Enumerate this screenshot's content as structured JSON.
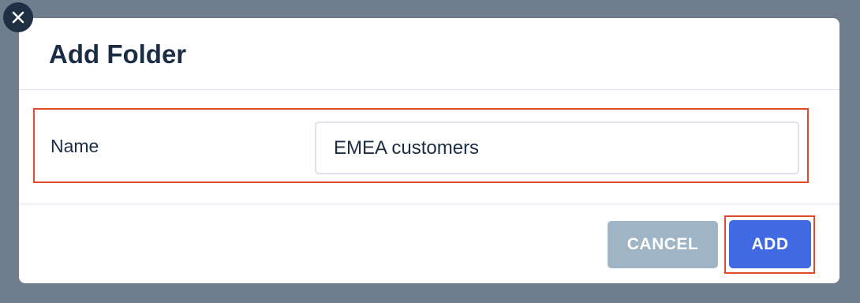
{
  "dialog": {
    "title": "Add Folder",
    "close_icon": "close-icon",
    "field": {
      "label": "Name",
      "value": "EMEA customers"
    },
    "buttons": {
      "cancel_label": "CANCEL",
      "add_label": "ADD"
    }
  },
  "colors": {
    "backdrop": "#6f7d8d",
    "title_text": "#1b2d45",
    "close_button_bg": "#1f3044",
    "cancel_button_bg": "#9fb4c4",
    "add_button_bg": "#4169e1",
    "highlight_border": "#e0492c"
  }
}
